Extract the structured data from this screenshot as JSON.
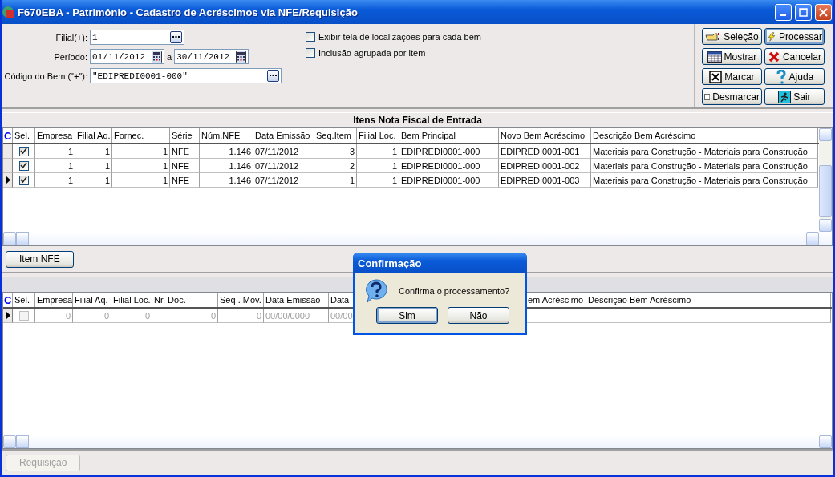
{
  "window": {
    "title": "F670EBA - Patrimônio - Cadastro de Acréscimos via NFE/Requisição"
  },
  "filter": {
    "filial": {
      "label": "Filial(+):",
      "value": "1"
    },
    "periodo": {
      "label": "Período:",
      "from": "01/11/2012",
      "separator": "a",
      "to": "30/11/2012"
    },
    "codigo": {
      "label": "Código do Bem (\"+\"):",
      "value": "\"EDIPREDI0001-000\""
    }
  },
  "options": [
    {
      "label": "Exibir tela de localizações para cada bem",
      "checked": false
    },
    {
      "label": "Inclusão agrupada por item",
      "checked": false
    }
  ],
  "actions": [
    {
      "label": "Seleção",
      "focused": false
    },
    {
      "label": "Processar",
      "focused": true
    },
    {
      "label": "Mostrar",
      "focused": false
    },
    {
      "label": "Cancelar",
      "focused": false
    },
    {
      "label": "Marcar",
      "focused": false
    },
    {
      "label": "Ajuda",
      "focused": false
    },
    {
      "label": "Desmarcar",
      "focused": false
    },
    {
      "label": "Sair",
      "focused": false
    }
  ],
  "grid1": {
    "title": "Itens Nota Fiscal de Entrada",
    "corner": "C",
    "columns": [
      {
        "label": "Sel.",
        "kind": "check"
      },
      {
        "label": "Empresa",
        "kind": "number"
      },
      {
        "label": "Filial Aq.",
        "kind": "number"
      },
      {
        "label": "Fornec.",
        "kind": "number"
      },
      {
        "label": "Série",
        "kind": "text"
      },
      {
        "label": "Núm.NFE",
        "kind": "number"
      },
      {
        "label": "Data Emissão",
        "kind": "text"
      },
      {
        "label": "Seq.Item",
        "kind": "number"
      },
      {
        "label": "Filial Loc.",
        "kind": "number"
      },
      {
        "label": "Bem Principal",
        "kind": "text"
      },
      {
        "label": "Novo Bem Acréscimo",
        "kind": "text"
      },
      {
        "label": "Descrição Bem Acréscimo",
        "kind": "text"
      }
    ],
    "rows": [
      {
        "selected": false,
        "checked": true,
        "disabled": false,
        "cells": [
          "",
          "1",
          "1",
          "1",
          "NFE",
          "1.146",
          "07/11/2012",
          "3",
          "1",
          "EDIPREDI0001-000",
          "EDIPREDI0001-001",
          "Materiais para Construção - Materiais para Construção"
        ]
      },
      {
        "selected": false,
        "checked": true,
        "disabled": false,
        "cells": [
          "",
          "1",
          "1",
          "1",
          "NFE",
          "1.146",
          "07/11/2012",
          "2",
          "1",
          "EDIPREDI0001-000",
          "EDIPREDI0001-002",
          "Materiais para Construção - Materiais para Construção"
        ]
      },
      {
        "selected": true,
        "checked": true,
        "disabled": false,
        "cells": [
          "",
          "1",
          "1",
          "1",
          "NFE",
          "1.146",
          "07/11/2012",
          "1",
          "1",
          "EDIPREDI0001-000",
          "EDIPREDI0001-003",
          "Materiais para Construção - Materiais para Construção"
        ]
      }
    ]
  },
  "item_button": {
    "label": "Item NFE"
  },
  "grid2": {
    "corner": "C",
    "columns": [
      {
        "label": "Sel.",
        "kind": "check"
      },
      {
        "label": "Empresa",
        "kind": "number"
      },
      {
        "label": "Filial Aq.",
        "kind": "number"
      },
      {
        "label": "Filial Loc.",
        "kind": "number"
      },
      {
        "label": "Nr. Doc.",
        "kind": "number"
      },
      {
        "label": "Seq . Mov.",
        "kind": "number"
      },
      {
        "label": "Data Emissão",
        "kind": "text"
      },
      {
        "label": "Data",
        "kind": "text"
      },
      {
        "label": "em Acréscimo",
        "kind": "text"
      },
      {
        "label": "Descrição Bem Acréscimo",
        "kind": "text"
      }
    ],
    "rows": [
      {
        "selected": true,
        "checked": false,
        "disabled": true,
        "cells": [
          "",
          "0",
          "0",
          "0",
          "0",
          "0",
          "00/00/0000",
          "00/00"
        ]
      }
    ]
  },
  "requisicao_button": {
    "label": "Requisição",
    "disabled": true
  },
  "dialog": {
    "title": "Confirmação",
    "message": "Confirma o processamento?",
    "buttons": [
      {
        "label": "Sim",
        "focused": true
      },
      {
        "label": "Não",
        "focused": false
      }
    ]
  }
}
